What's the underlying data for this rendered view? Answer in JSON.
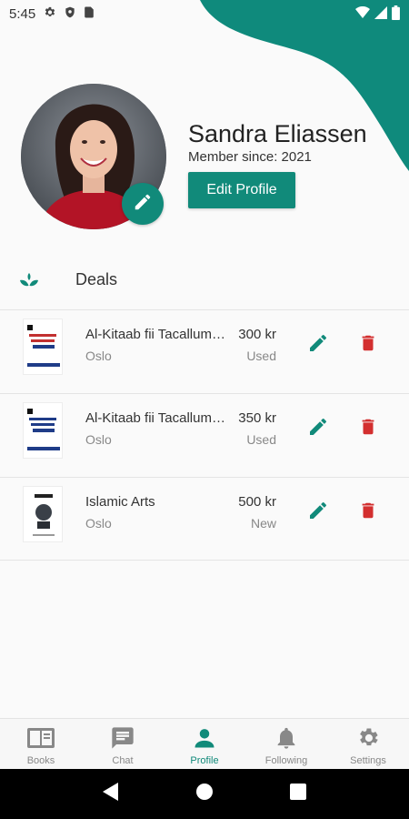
{
  "status_bar": {
    "time": "5:45"
  },
  "profile": {
    "name": "Sandra Eliassen",
    "member_since": "Member since: 2021",
    "edit_profile_label": "Edit Profile"
  },
  "deals_section": {
    "title": "Deals"
  },
  "deals": [
    {
      "title": "Al-Kitaab fii Tacallum ...",
      "city": "Oslo",
      "price": "300 kr",
      "condition": "Used"
    },
    {
      "title": "Al-Kitaab fii Tacallum ...",
      "city": "Oslo",
      "price": "350 kr",
      "condition": "Used"
    },
    {
      "title": "Islamic Arts",
      "city": "Oslo",
      "price": "500 kr",
      "condition": "New"
    }
  ],
  "bottom_nav": [
    {
      "label": "Books",
      "icon": "book-icon"
    },
    {
      "label": "Chat",
      "icon": "chat-icon"
    },
    {
      "label": "Profile",
      "icon": "person-icon",
      "active": true
    },
    {
      "label": "Following",
      "icon": "bell-icon"
    },
    {
      "label": "Settings",
      "icon": "gear-icon"
    }
  ],
  "colors": {
    "accent": "#118a7a",
    "delete": "#d32f2f",
    "inactive": "#888888"
  }
}
